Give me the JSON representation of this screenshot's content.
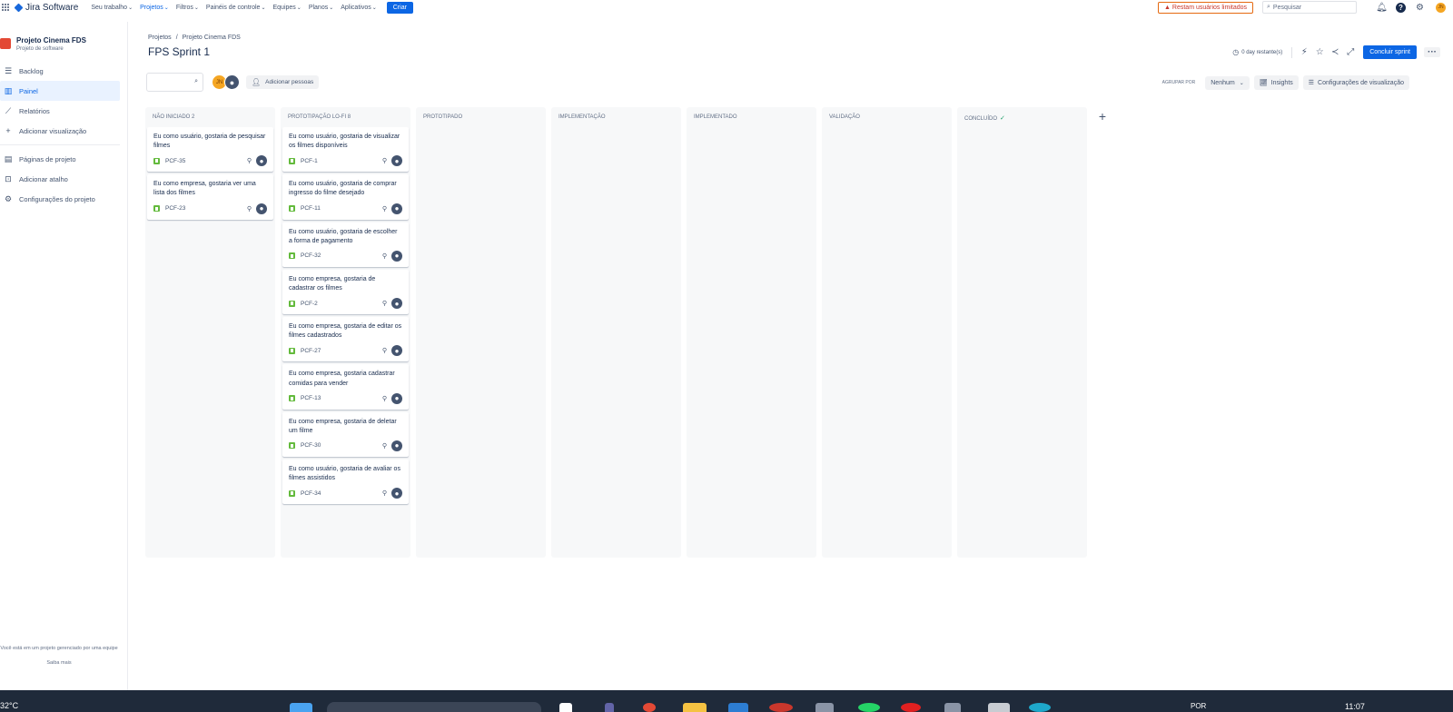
{
  "topnav": {
    "app_name": "Jira Software",
    "items": [
      {
        "label": "Seu trabalho",
        "active": false
      },
      {
        "label": "Projetos",
        "active": true
      },
      {
        "label": "Filtros",
        "active": false
      },
      {
        "label": "Painéis de controle",
        "active": false
      },
      {
        "label": "Equipes",
        "active": false
      },
      {
        "label": "Planos",
        "active": false
      },
      {
        "label": "Aplicativos",
        "active": false
      }
    ],
    "create_label": "Criar",
    "warning_label": "Restam usuários limitados",
    "search_placeholder": "Pesquisar",
    "user_initials": "JN"
  },
  "sidebar": {
    "project_name": "Projeto Cinema FDS",
    "project_type": "Projeto de software",
    "items": [
      {
        "label": "Backlog",
        "icon": "backlog-icon"
      },
      {
        "label": "Painel",
        "icon": "board-icon",
        "active": true
      },
      {
        "label": "Relatórios",
        "icon": "reports-icon"
      },
      {
        "label": "Adicionar visualização",
        "icon": "plus-icon"
      }
    ],
    "items2": [
      {
        "label": "Páginas de projeto",
        "icon": "page-icon"
      },
      {
        "label": "Adicionar atalho",
        "icon": "shortcut-icon"
      },
      {
        "label": "Configurações do projeto",
        "icon": "gear-icon"
      }
    ],
    "footer_text": "Você está em um projeto gerenciado por uma equipe",
    "learn_more": "Saiba mais"
  },
  "header": {
    "breadcrumb": [
      "Projetos",
      "Projeto Cinema FDS"
    ],
    "title": "FPS Sprint 1",
    "days_left": "0 day restante(s)",
    "complete_sprint": "Concluir sprint",
    "more": "···"
  },
  "toolbar": {
    "avatar_initials": "JN",
    "add_people": "Adicionar pessoas",
    "group_by_label": "AGRUPAR POR",
    "group_by_value": "Nenhum",
    "insights": "Insights",
    "view_settings": "Configurações de visualização"
  },
  "columns": [
    {
      "title": "NÃO INICIADO 2",
      "done": false,
      "cards": [
        {
          "text": "Eu como usuário, gostaria de pesquisar filmes",
          "key": "PCF-35"
        },
        {
          "text": "Eu como empresa, gostaria ver uma lista dos filmes",
          "key": "PCF-23"
        }
      ]
    },
    {
      "title": "PROTOTIPAÇÃO LO-FI 8",
      "done": false,
      "cards": [
        {
          "text": "Eu como usuário, gostaria de visualizar os filmes disponíveis",
          "key": "PCF-1"
        },
        {
          "text": "Eu como usuário, gostaria de comprar ingresso do filme desejado",
          "key": "PCF-11"
        },
        {
          "text": "Eu como usuário, gostaria de escolher a forma de pagamento",
          "key": "PCF-32"
        },
        {
          "text": "Eu como empresa, gostaria de cadastrar os filmes",
          "key": "PCF-2"
        },
        {
          "text": "Eu como empresa, gostaria de editar os filmes cadastrados",
          "key": "PCF-27"
        },
        {
          "text": "Eu como empresa, gostaria cadastrar comidas para vender",
          "key": "PCF-13"
        },
        {
          "text": "Eu como empresa, gostaria de deletar um filme",
          "key": "PCF-30"
        },
        {
          "text": "Eu como usuário, gostaria de avaliar os filmes assistidos",
          "key": "PCF-34"
        }
      ]
    },
    {
      "title": "PROTOTIPADO",
      "done": false,
      "cards": []
    },
    {
      "title": "IMPLEMENTAÇÃO",
      "done": false,
      "cards": []
    },
    {
      "title": "IMPLEMENTADO",
      "done": false,
      "cards": []
    },
    {
      "title": "VALIDAÇÃO",
      "done": false,
      "cards": []
    },
    {
      "title": "CONCLUÍDO",
      "done": true,
      "cards": []
    }
  ],
  "taskbar": {
    "temperature": "32°C",
    "language": "POR",
    "time": "11:07"
  }
}
